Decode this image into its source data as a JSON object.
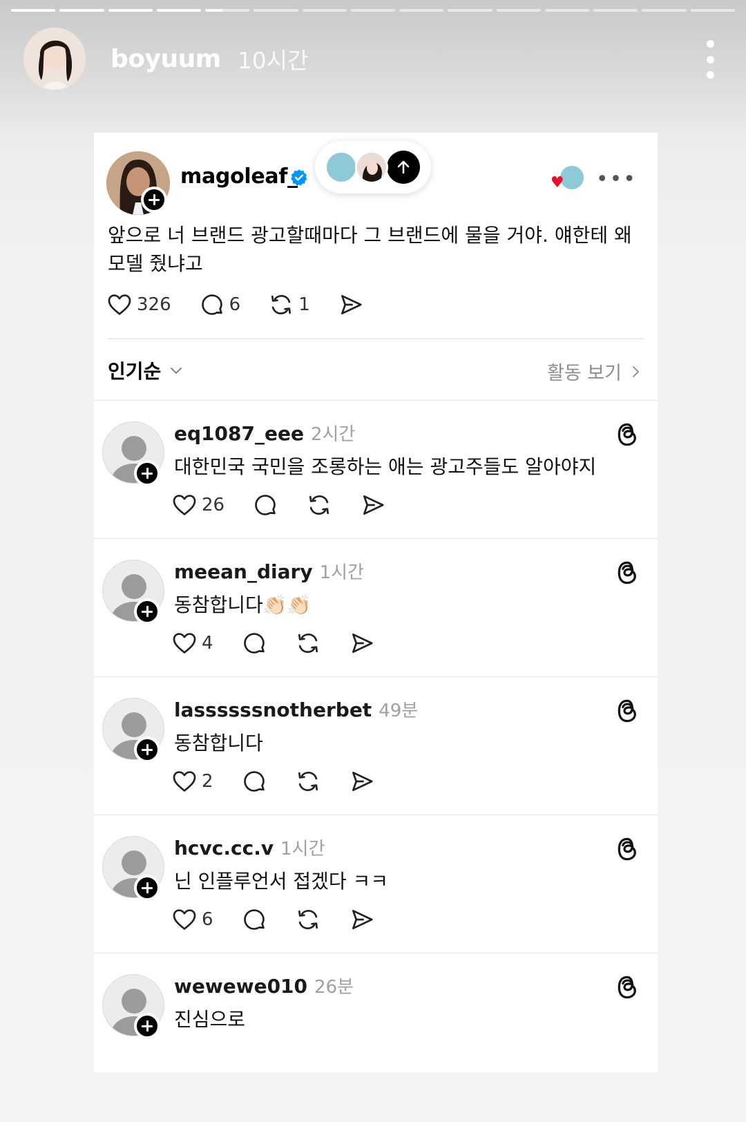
{
  "story": {
    "username": "boyuum",
    "time": "10시간",
    "segments_total": 15,
    "segments_done": 4,
    "current_progress": 0.4
  },
  "post": {
    "username": "magoleaf_",
    "verified": true,
    "text": "앞으로 너 브랜드 광고할때마다 그 브랜드에 물을 거야. 얘한테 왜 모델 줬냐고",
    "likes": "326",
    "comments": "6",
    "reposts": "1"
  },
  "sort": {
    "label": "인기순",
    "activity_label": "활동 보기"
  },
  "replies": [
    {
      "username": "eq1087_eee",
      "time": "2시간",
      "text": "대한민국 국민을 조롱하는 애는 광고주들도 알아야지",
      "likes": "26"
    },
    {
      "username": "meean_diary",
      "time": "1시간",
      "text": "동참합니다👏🏻👏🏻",
      "likes": "4"
    },
    {
      "username": "lassssssnotherbet",
      "time": "49분",
      "text": "동참합니다",
      "likes": "2"
    },
    {
      "username": "hcvc.cc.v",
      "time": "1시간",
      "text": "닌 인플루언서 접겠다 ㅋㅋ",
      "likes": "6"
    },
    {
      "username": "wewewe010",
      "time": "26분",
      "text": "진심으로",
      "likes": ""
    }
  ],
  "colors": {
    "verified": "#0095f6",
    "heart": "#e8112d",
    "muted": "#a0a0a0"
  }
}
